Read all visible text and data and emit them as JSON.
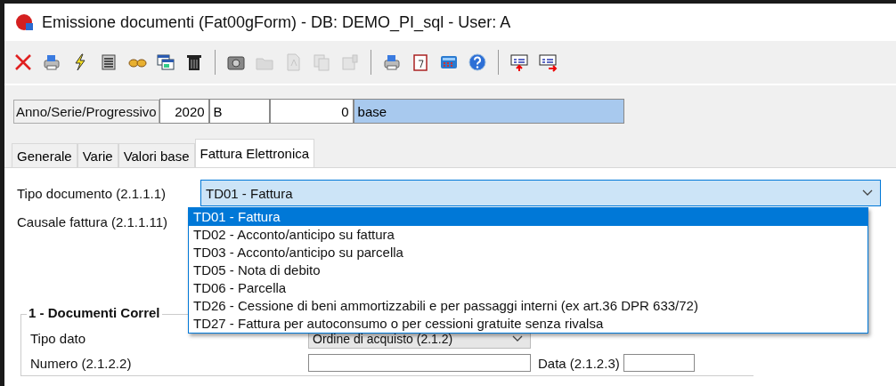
{
  "window": {
    "title": "Emissione documenti  (Fat00gForm) - DB: DEMO_PI_sql - User: A"
  },
  "toolbar": [
    {
      "kind": "close",
      "disabled": false
    },
    {
      "kind": "printer",
      "disabled": false
    },
    {
      "kind": "lightning",
      "disabled": false
    },
    {
      "kind": "list",
      "disabled": false
    },
    {
      "kind": "binoculars",
      "disabled": false
    },
    {
      "kind": "windows",
      "disabled": false
    },
    {
      "kind": "trash",
      "disabled": false
    },
    {
      "kind": "separator"
    },
    {
      "kind": "camera",
      "disabled": false
    },
    {
      "kind": "folder",
      "disabled": true
    },
    {
      "kind": "pdf",
      "disabled": true
    },
    {
      "kind": "copy",
      "disabled": true
    },
    {
      "kind": "attach",
      "disabled": true
    },
    {
      "kind": "separator"
    },
    {
      "kind": "printer",
      "disabled": false
    },
    {
      "kind": "calendar",
      "disabled": false
    },
    {
      "kind": "calculator",
      "disabled": false
    },
    {
      "kind": "help",
      "disabled": false
    },
    {
      "kind": "separator"
    },
    {
      "kind": "record-up",
      "disabled": false
    },
    {
      "kind": "record-right",
      "disabled": false
    }
  ],
  "header": {
    "label": "Anno/Serie/Progressivo",
    "anno": "2020",
    "serie": "B",
    "progressivo": "0",
    "description": "base"
  },
  "tabs": [
    {
      "label": "Generale",
      "selected": false
    },
    {
      "label": "Varie",
      "selected": false
    },
    {
      "label": "Valori base",
      "selected": false
    },
    {
      "label": "Fattura Elettronica",
      "selected": true
    }
  ],
  "form": {
    "tipo_documento": {
      "label": "Tipo documento (2.1.1.1)",
      "value": "TD01 - Fattura",
      "expanded": true,
      "options": [
        {
          "label": "TD01 - Fattura",
          "selected": true
        },
        {
          "label": "TD02 - Acconto/anticipo su fattura",
          "selected": false
        },
        {
          "label": "TD03 - Acconto/anticipo su parcella",
          "selected": false
        },
        {
          "label": "TD05 - Nota di debito",
          "selected": false
        },
        {
          "label": "TD06 - Parcella",
          "selected": false
        },
        {
          "label": "TD26 - Cessione di beni ammortizzabili e per passaggi interni (ex art.36 DPR 633/72)",
          "selected": false
        },
        {
          "label": "TD27 - Fattura per autoconsumo o per cessioni gratuite senza rivalsa",
          "selected": false
        }
      ]
    },
    "causale_label": "Causale fattura (2.1.1.11)",
    "group": {
      "title": "1 - Documenti Correl",
      "tipo_dato_label": "Tipo dato",
      "tipo_dato_value": "Ordine di acquisto (2.1.2)",
      "numero_label": "Numero (2.1.2.2)",
      "data_label": "Data (2.1.2.3)"
    }
  }
}
